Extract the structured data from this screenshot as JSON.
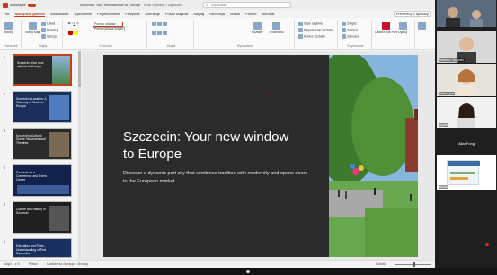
{
  "window": {
    "autosave_label": "Autozapis",
    "file_name": "Szczecin: Your new window to Europe",
    "save_status": "Brak etykiety • Zapisano",
    "search_placeholder": "Wyszukaj"
  },
  "tabs": [
    "Plik",
    "Narzędzia główne",
    "Wstawianie",
    "Rysowanie",
    "Projektowanie",
    "Przejścia",
    "Animacje",
    "Pokaz slajdów",
    "Nagraj",
    "Recenzja",
    "Widok",
    "Pomoc",
    "Acrobat"
  ],
  "active_tab": "Narzędzia główne",
  "share_label": "Prezentuj w aplikacji",
  "ribbon": {
    "paste": "Wklej",
    "new_slide": "Nowy slajd",
    "reuse": "Ponownie użyj slajdów",
    "layout": "Układ",
    "reset": "Resetuj",
    "section": "Sekcja",
    "font_value": "Pomoc ołówka",
    "font_tooltip": "Pomoc pisaka dotyku",
    "shapes_label": "Kształty",
    "arrange": "Rozmieść",
    "quick_styles": "Style szybkie",
    "shape_fill": "Wypełnienie kształtu",
    "shape_outline": "Kontur kształtu",
    "shape_effects": "Efekty kształtu",
    "find": "Znajdź",
    "replace": "Zamień",
    "select": "Zaznacz",
    "find2": "Znajdź i zamień",
    "adobe": "Utwórz plik PDF",
    "dictate": "Dyktuj",
    "designer": "Projektant",
    "group_clipboard": "Schowek",
    "group_slides": "Slajdy",
    "group_font": "Czcionka",
    "group_paragraph": "Akapit",
    "group_drawing": "Rysowanie",
    "group_editing": "Edytowanie",
    "group_acrobat": "Adobe Acrobat",
    "group_voice": "Głos",
    "group_designer": "Projektant"
  },
  "thumbnails": [
    {
      "num": "1",
      "title": "Szczecin: Your new window to Europe",
      "bg": "#2b2b2b",
      "accent": "#3e7d3a"
    },
    {
      "num": "2",
      "title": "Szczecin's Location: A Gateway to Northern Europe",
      "bg": "#1a2f5a",
      "accent": "#4f7dbf"
    },
    {
      "num": "3",
      "title": "Szczecin's Cultural Scene: Museums and Theatres",
      "bg": "#2a2a2a",
      "accent": "#7a6a55"
    },
    {
      "num": "4",
      "title": "Szczecin as a Conference and Event Center",
      "bg": "#13224a",
      "accent": "#3d5c9a"
    },
    {
      "num": "5",
      "title": "Culture and History in Szczecin",
      "bg": "#202020",
      "accent": "#555555"
    },
    {
      "num": "6",
      "title": "Education and Ports - Understanding of Port Dynamics",
      "bg": "#17305e",
      "accent": "#2e6bb0"
    }
  ],
  "slide": {
    "title": "Szczecin: Your new window to Europe",
    "subtitle": "Discover a dynamic port city that combines tradition with modernity and opens doors to the European market"
  },
  "status": {
    "slide_count": "Slajd 1 z 6",
    "language": "Polski",
    "accessibility": "Ułatwienia dostępu: Zbadaj",
    "notes": "Notatki"
  },
  "participants": [
    {
      "name": "Mariusz Okupski"
    },
    {
      "name": "Katarzyna"
    },
    {
      "name": "Agata"
    },
    {
      "name": "AllanFong"
    },
    {
      "name": "Beata"
    }
  ],
  "colors": {
    "accent": "#c43e1c",
    "slide_bg": "#2b2b2b"
  }
}
